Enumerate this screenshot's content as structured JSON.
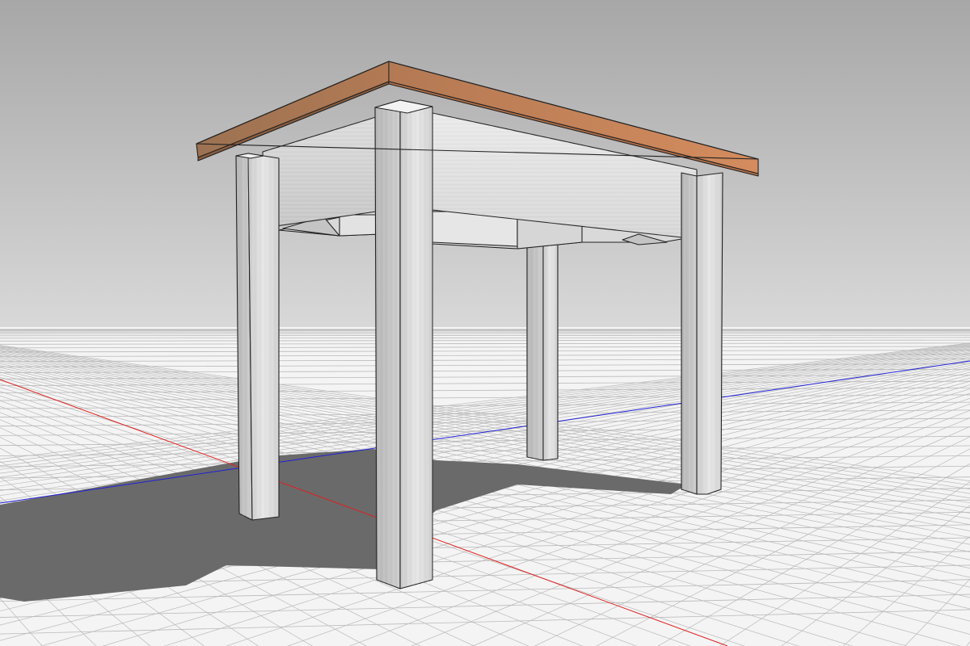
{
  "viewport": {
    "background_top_color": "#a7a7a7",
    "background_horizon_color": "#d9d9d9",
    "ground_color": "#f4f4f4",
    "grid_line_color": "#b9b9b9",
    "shadow_color": "#6a6a6a",
    "axes": {
      "x_axis_color": "#e02020",
      "z_axis_color": "#2020d8"
    }
  },
  "model": {
    "object": "table",
    "tabletop_color": "#c9835a",
    "tabletop_edge_color": "#6e4630",
    "wood_light_color": "#eeeeee",
    "wood_mid_color": "#d2d2d2",
    "wood_dark_color": "#b9b9b9",
    "outline_color": "#222222",
    "leg_count": 4
  }
}
